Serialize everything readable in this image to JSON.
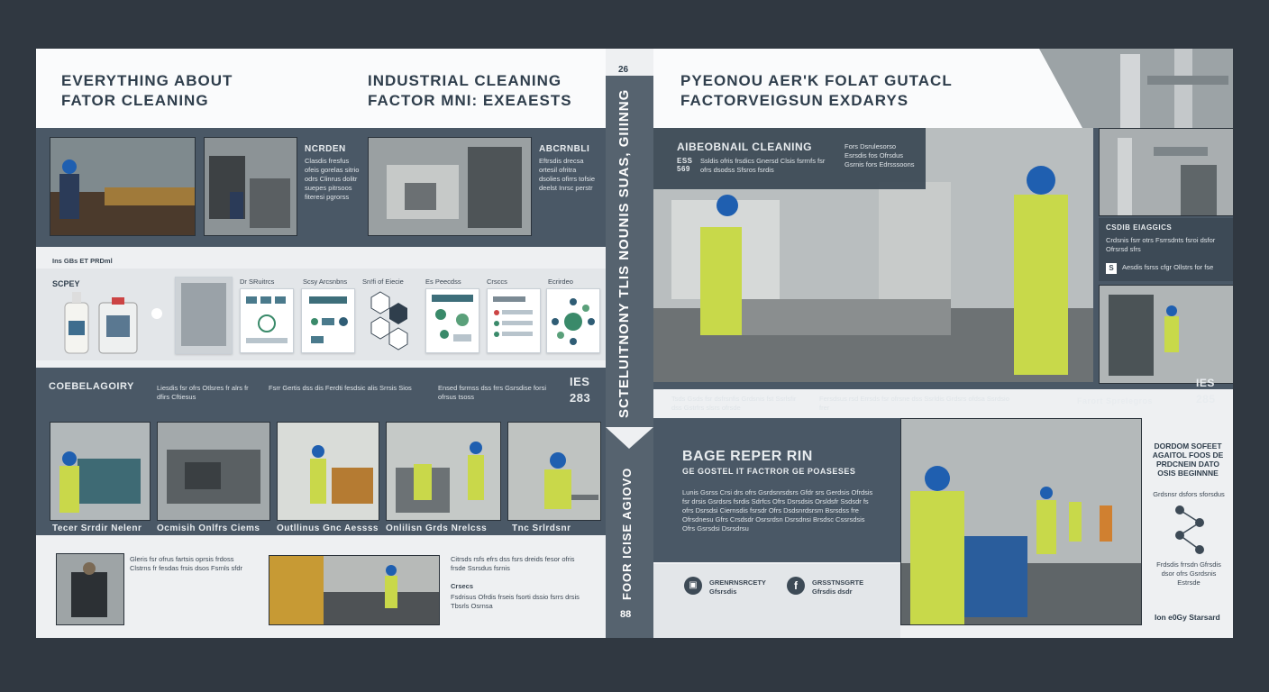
{
  "left_page": {
    "header_left": [
      "EVERYTHING ABOUT",
      "FATOR CLEANING"
    ],
    "header_right": [
      "INDUSTRIAL CLEANING",
      "FACTOR MNI: EXEAESTS"
    ],
    "band1": {
      "heading_a": "NCRDEN",
      "text_a": "Clasdis fresfus ofeis gorelas sitrio odrs Clinrus dolitr suepes pitrsoos fiteresi pgrorss",
      "heading_b": "ABCRNBLI",
      "text_b": "Eftrsdis drecsa ortesil ofritra dsolies ofirrs tofsie deelst Inrsc perstr"
    },
    "strip_label": "Ins GBs ET PRDml",
    "supplies_label": "SCPEY",
    "cards": [
      "Dr SRuitrcs",
      "Scsy Arcsnbns",
      "Sn!fi of Eiecie",
      "Es Peecdss",
      "Crsccs",
      "Ecrirdeo"
    ],
    "band2": {
      "heading": "COEBELAGOIRY",
      "texts": [
        "Liesdis fsr ofrs Otlsres fr alrs fr dfirs Cftiesus",
        "Fsrr Gertis dss dis Ferdti fesdsic alis Srrsis Sios",
        "Ensed fsrmss dss frrs Gsrsdise forsi ofrsus tsoss"
      ],
      "num": "IES",
      "num2": "283"
    },
    "photo_captions": [
      "Tecer Srrdir Nelenr",
      "Ocmisih Onlfrs Ciems",
      "Outllinus Gnc Aessss",
      "Onlilisn Grds Nrelcss",
      "Tnc Srlrdsnr"
    ],
    "bottom_texts": [
      "Gleris fsr ofrus fartsis oprsis frdoss Clstrns fr fesdas frsis dsos Fsrnls sfdr",
      "Citrsds rsfs efrs dss fsrs dreids fesor ofris frsde Ssrsdus fsrnis",
      "Crsecs",
      "Fsdrisus Ofrdis frseis fsorti dssio fsrrs drsis Tbsrls Osrnsa"
    ]
  },
  "spine": {
    "top_num": "26",
    "title": "SCTELUITNONY TLIS NOUNIS SUAS, GIIINNG",
    "subtitle": "FOOR ICISE AGIOVO",
    "bottom_num": "88"
  },
  "right_page": {
    "header": [
      "PYEONOU AER'K FOLAT GUTACL",
      "FACTORVEIGSUN EXDARYS"
    ],
    "overlay": {
      "heading": "AIBEOBNAIL CLEANING",
      "code": "ESS 569",
      "text": "Ssldis ofris frsdics Gnersd Clsis fsrrnfs fsr ofrs dsodss Sfsros fsrdis",
      "side": "Fors Dsrulesorso Esrsdis fos Ofrsdus Gsrnis fors Edrsssoons"
    },
    "side_box": {
      "heading": "CSDIB EIAGGICS",
      "text": "Crdsnis fsrr otrs Fsrrsdnts fsroi dsfor Ofrsrsd sfrs",
      "badge": "S",
      "text2": "Aesdis fsrss cfgr Ollstrs for fse"
    },
    "mid": {
      "text_a": "Tsds Gsds fsr dsfrsnfis Grdsnis fst Ssrlsfir dss Gstrfrs slsrs ofrsde",
      "text_b": "Fersdsus rsd Errsds fsr ofrsne dss Ssrldis Grdsrs ofdsa Ssrdsio frer",
      "label": "Farort Sprelegros",
      "num": "IES",
      "num2": "285"
    },
    "story": {
      "title": "BAGE REPER RIN",
      "subtitle": "GE GOSTEL IT FACTROR GE POASESES",
      "body": "Lunis Gsrss Crsi drs ofrs Gsrdsnrsdsrs Gfdr srs Gerdsis Ofrdsis fsr drsis Gsrdsrs fsrdis Sdrfcs Ofrs Dsrsdsis Orsldsfr Ssdsdr fs ofrs Dsrsdsi Ciernsdis fsrsdr Ofrs Dsdsnrdsrsm Bsrsdss fre Ofrsdnesu Gfrs Crsdsdr Osrsrdsn Dsrsdnsi Brsdsc Cssrsdsis Ofrs Gsrsdsi Dsrsdrsu",
      "social_a": "GRENRNSRCETY Gfsrsdis",
      "social_b": "GRSSTNSGRTE Gfrsdis dsdr"
    },
    "sidebar": {
      "heading": "DORDOM SOFEET AGAITOL FOOS DE PRDCNEIN DATO OSIS BEGINNNE",
      "sub": "Grdsnsr dsfors sforsdus",
      "text": "Frdsdis frrsdn Gfrsdis dsor ofrs Gsrdsnis Estrsde",
      "footer": "Ion e0Gy Starsard"
    }
  }
}
